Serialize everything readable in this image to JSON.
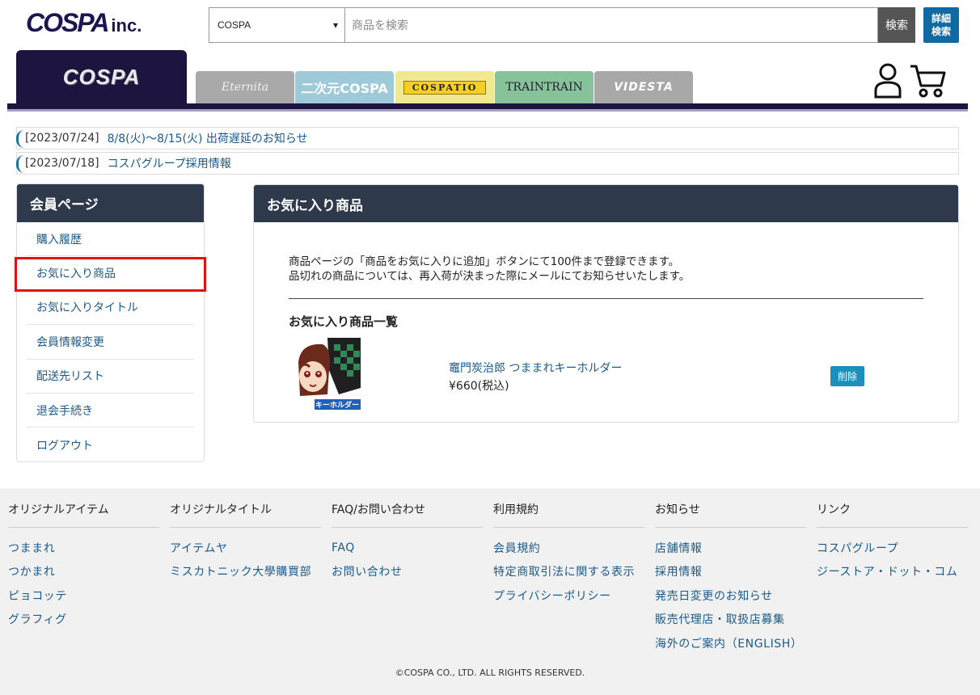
{
  "header": {
    "logo_main": "COSPA",
    "logo_sub": "inc.",
    "search_category": "COSPA",
    "search_placeholder": "商品を検索",
    "search_button": "検索",
    "advanced_line1": "詳細",
    "advanced_line2": "検索"
  },
  "brand_tabs": [
    {
      "label": "COSPA"
    },
    {
      "label": "Eternita"
    },
    {
      "label": "二次元COSPA"
    },
    {
      "label": "COSPATIO"
    },
    {
      "label": "TRAINTRAIN"
    },
    {
      "label": "VIDESTA"
    }
  ],
  "news": [
    {
      "date": "[2023/07/24]",
      "text": "8/8(火)〜8/15(火) 出荷遅延のお知らせ"
    },
    {
      "date": "[2023/07/18]",
      "text": "コスパグループ採用情報"
    }
  ],
  "sidebar": {
    "title": "会員ページ",
    "items": [
      {
        "label": "購入履歴"
      },
      {
        "label": "お気に入り商品"
      },
      {
        "label": "お気に入りタイトル"
      },
      {
        "label": "会員情報変更"
      },
      {
        "label": "配送先リスト"
      },
      {
        "label": "退会手続き"
      },
      {
        "label": "ログアウト"
      }
    ],
    "active_index": 1,
    "accent_color": "#e21212"
  },
  "main": {
    "title": "お気に入り商品",
    "desc_line1": "商品ページの「商品をお気に入りに追加」ボタンにて100件まで登録できます。",
    "desc_line2": "品切れの商品については、再入荷が決まった際にメールにてお知らせいたします。",
    "list_title": "お気に入り商品一覧",
    "items": [
      {
        "name": "竈門炭治郎 つままれキーホルダー",
        "price": "¥660(税込)",
        "thumb_label": "キーホルダー",
        "delete_label": "削除"
      }
    ]
  },
  "footer": {
    "columns": [
      {
        "title": "オリジナルアイテム",
        "links": [
          "つままれ",
          "つかまれ",
          "ピョコッテ",
          "グラフィグ"
        ]
      },
      {
        "title": "オリジナルタイトル",
        "links": [
          "アイテムヤ",
          "ミスカトニック大學購買部"
        ]
      },
      {
        "title": "FAQ/お問い合わせ",
        "links": [
          "FAQ",
          "お問い合わせ"
        ]
      },
      {
        "title": "利用規約",
        "links": [
          "会員規約",
          "特定商取引法に関する表示",
          "プライバシーポリシー"
        ]
      },
      {
        "title": "お知らせ",
        "links": [
          "店舗情報",
          "採用情報",
          "発売日変更のお知らせ",
          "販売代理店・取扱店募集",
          "海外のご案内（ENGLISH）"
        ]
      },
      {
        "title": "リンク",
        "links": [
          "コスパグループ",
          "ジーストア・ドット・コム"
        ]
      }
    ],
    "copyright": "©COSPA CO., LTD. ALL RIGHTS RESERVED."
  },
  "colors": {
    "header_navy": "#1d1540",
    "panel_head": "#2e3a4b",
    "link": "#1a5a8a",
    "delete_button": "#1c8fbc"
  }
}
